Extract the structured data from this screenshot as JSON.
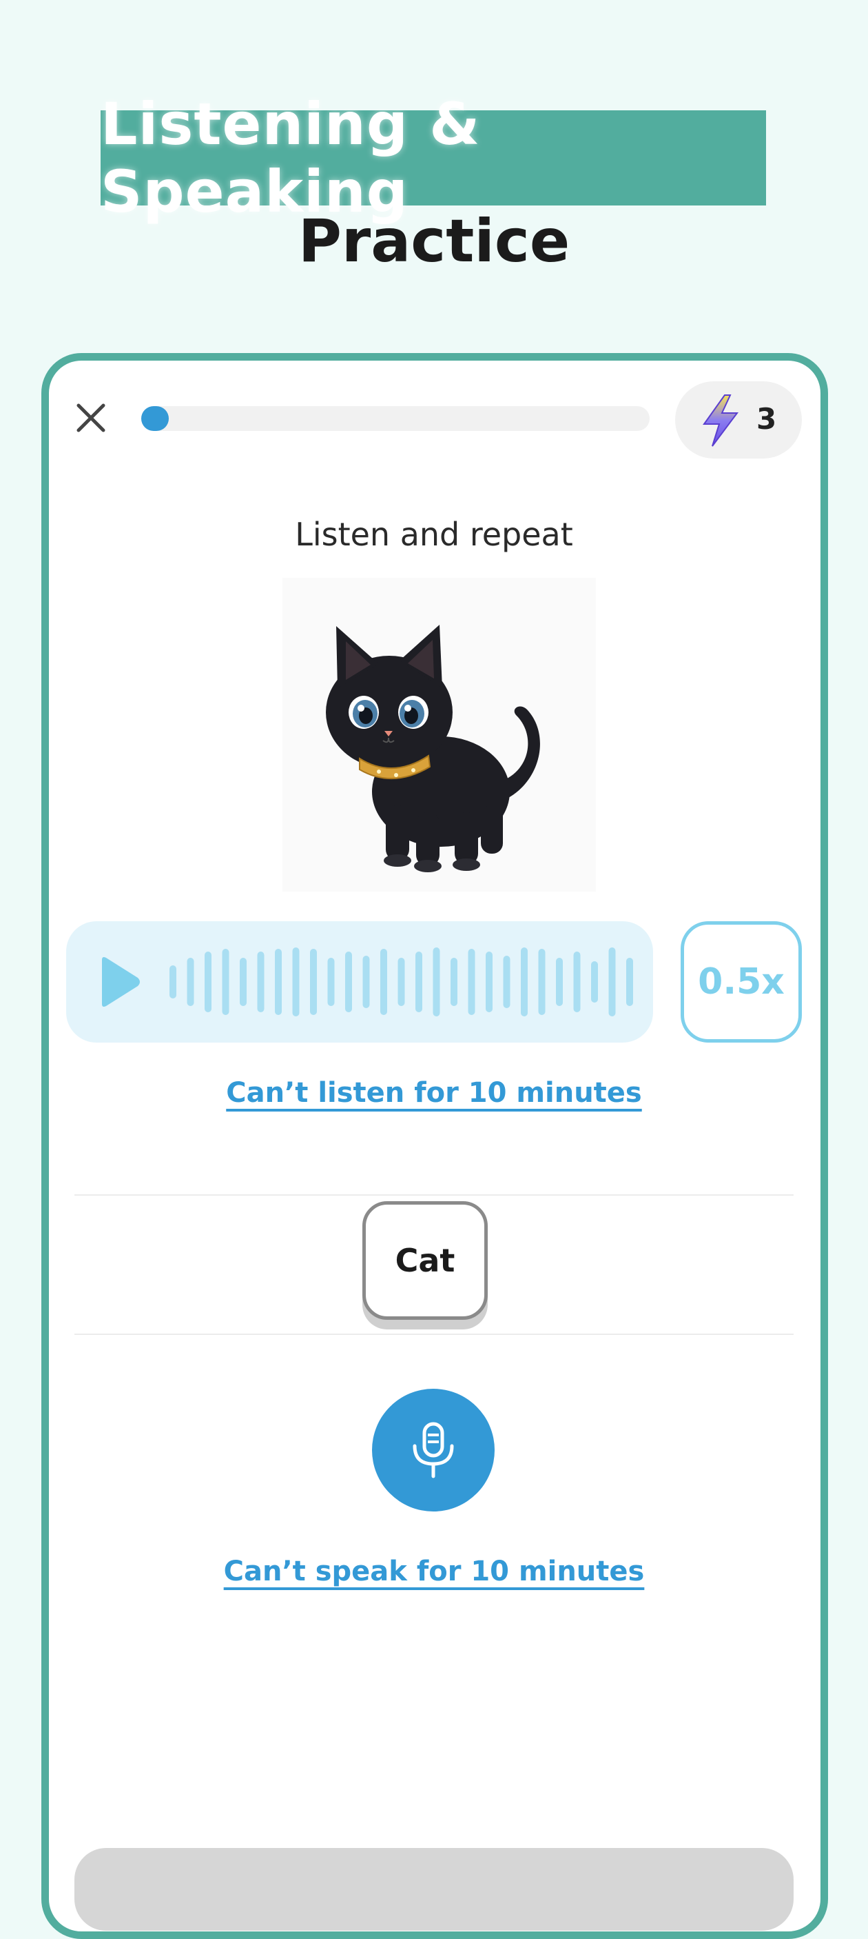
{
  "promo": {
    "headline": "Listening & Speaking",
    "subheadline": "Practice"
  },
  "header": {
    "close_icon": "close-icon",
    "progress": 0.05,
    "energy_icon": "lightning-icon",
    "energy_count": "3"
  },
  "exercise": {
    "instruction": "Listen and repeat",
    "image": "black-cat-illustration",
    "audio": {
      "play_icon": "play-icon",
      "speed_label": "0.5x"
    },
    "cant_listen_label": "Can’t listen for 10 minutes",
    "word": "Cat",
    "mic_icon": "microphone-icon",
    "cant_speak_label": "Can’t speak for 10 minutes"
  },
  "colors": {
    "brand_teal": "#52ad9e",
    "accent_blue": "#3399d6",
    "light_blue": "#7ed0ec",
    "audio_bg": "#e3f4fb"
  }
}
